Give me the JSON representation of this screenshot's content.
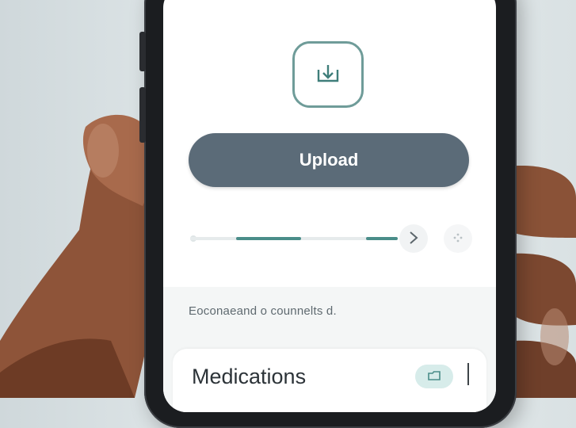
{
  "upload": {
    "icon": "upload-tray-icon",
    "button_label": "Upload"
  },
  "progress": {
    "next_icon": "chevron-right-icon",
    "more_icon": "dots-icon"
  },
  "caption": "Eoconaeand o counnelts d.",
  "medications_card": {
    "title": "Medications",
    "toggle_icon": "folder-toggle-icon"
  },
  "colors": {
    "accent": "#4a8d89",
    "button": "#5b6b78",
    "icon_border": "#6f9c99",
    "background": "#e3e9eb"
  }
}
